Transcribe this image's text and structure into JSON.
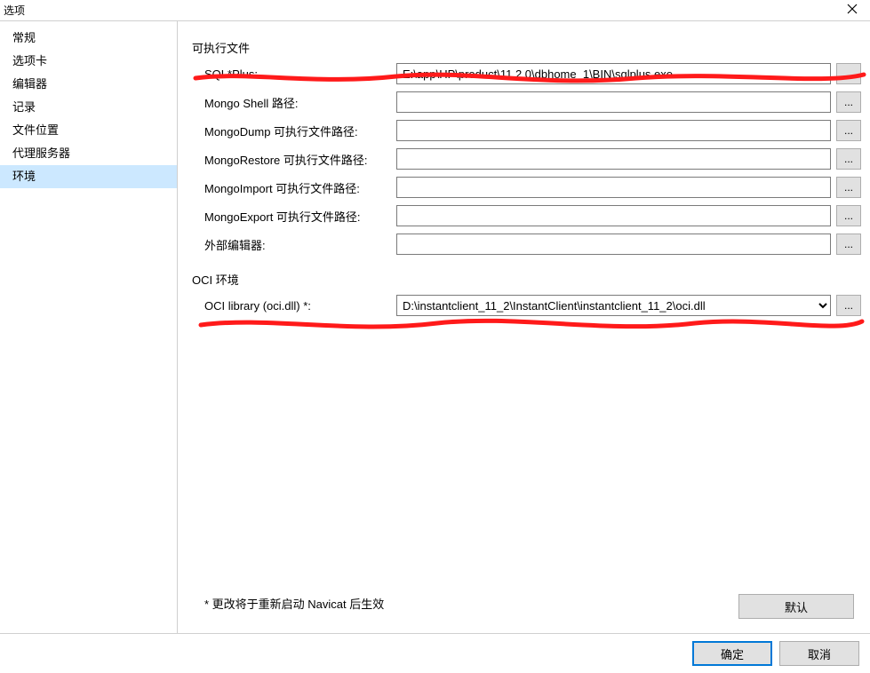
{
  "window": {
    "title": "选项"
  },
  "sidebar": {
    "items": [
      {
        "label": "常规"
      },
      {
        "label": "选项卡"
      },
      {
        "label": "编辑器"
      },
      {
        "label": "记录"
      },
      {
        "label": "文件位置"
      },
      {
        "label": "代理服务器"
      },
      {
        "label": "环境"
      }
    ],
    "selected_index": 6
  },
  "sections": {
    "exec": {
      "title": "可执行文件",
      "rows": [
        {
          "label": "SQL*Plus:",
          "value": "E:\\app\\HP\\product\\11.2.0\\dbhome_1\\BIN\\sqlplus.exe"
        },
        {
          "label": "Mongo Shell 路径:",
          "value": ""
        },
        {
          "label": "MongoDump 可执行文件路径:",
          "value": ""
        },
        {
          "label": "MongoRestore 可执行文件路径:",
          "value": ""
        },
        {
          "label": "MongoImport 可执行文件路径:",
          "value": ""
        },
        {
          "label": "MongoExport 可执行文件路径:",
          "value": ""
        },
        {
          "label": "外部编辑器:",
          "value": ""
        }
      ]
    },
    "oci": {
      "title": "OCI 环境",
      "rows": [
        {
          "label": "OCI library (oci.dll) *:",
          "value": "D:\\instantclient_11_2\\InstantClient\\instantclient_11_2\\oci.dll"
        }
      ]
    }
  },
  "note": "* 更改将于重新启动 Navicat 后生效",
  "buttons": {
    "default": "默认",
    "ok": "确定",
    "cancel": "取消",
    "browse": "..."
  },
  "annotation_color": "#ff0000"
}
